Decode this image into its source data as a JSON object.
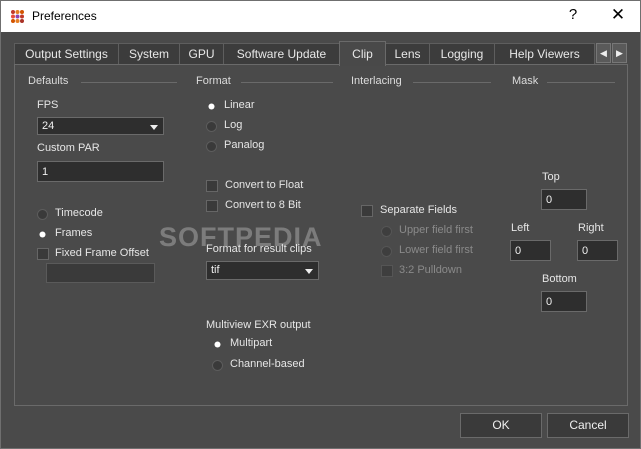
{
  "window": {
    "title": "Preferences",
    "help_glyph": "?",
    "close_glyph": "✕"
  },
  "tabs": [
    "Output Settings",
    "System",
    "GPU",
    "Software Update",
    "Clip",
    "Lens",
    "Logging",
    "Help Viewers"
  ],
  "active_tab": "Clip",
  "groups": {
    "defaults": "Defaults",
    "format": "Format",
    "interlacing": "Interlacing",
    "mask": "Mask"
  },
  "defaults": {
    "fps_label": "FPS",
    "fps_value": "24",
    "custom_par_label": "Custom PAR",
    "custom_par_value": "1",
    "timecode_label": "Timecode",
    "frames_label": "Frames",
    "fixed_offset_label": "Fixed Frame Offset",
    "fixed_offset_value": ""
  },
  "format": {
    "linear_label": "Linear",
    "log_label": "Log",
    "panalog_label": "Panalog",
    "convert_float_label": "Convert to Float",
    "convert_8bit_label": "Convert to 8 Bit",
    "result_clips_label": "Format for result clips",
    "result_clips_value": "tif",
    "multiview_label": "Multiview EXR output",
    "multipart_label": "Multipart",
    "channel_based_label": "Channel-based"
  },
  "interlacing": {
    "separate_fields_label": "Separate Fields",
    "upper_first_label": "Upper field first",
    "lower_first_label": "Lower field first",
    "pulldown_label": "3:2 Pulldown"
  },
  "mask": {
    "top_label": "Top",
    "top_value": "0",
    "left_label": "Left",
    "left_value": "0",
    "right_label": "Right",
    "right_value": "0",
    "bottom_label": "Bottom",
    "bottom_value": "0"
  },
  "buttons": {
    "ok": "OK",
    "cancel": "Cancel"
  },
  "watermark": "SOFTPEDIA"
}
